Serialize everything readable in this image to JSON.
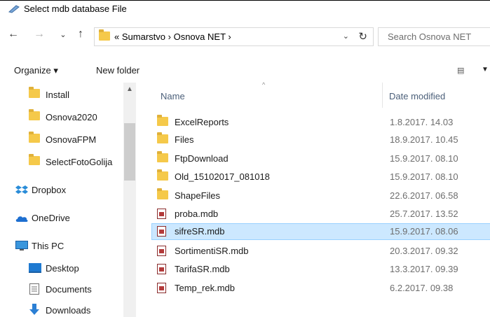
{
  "window": {
    "title": "Select mdb database File"
  },
  "address": {
    "crumb_prefix": "«",
    "crumbs": [
      "Sumarstvo",
      "Osnova NET"
    ],
    "separator": "›"
  },
  "search": {
    "placeholder": "Search Osnova NET"
  },
  "toolbar": {
    "organize": "Organize ▾",
    "new_folder": "New folder"
  },
  "nav": {
    "items": [
      {
        "label": "Install",
        "icon": "folder-icon"
      },
      {
        "label": "Osnova2020",
        "icon": "folder-icon"
      },
      {
        "label": "OsnovaFPM",
        "icon": "folder-icon"
      },
      {
        "label": "SelectFotoGolija",
        "icon": "folder-icon"
      },
      {
        "label": "Dropbox",
        "icon": "dropbox-icon"
      },
      {
        "label": "OneDrive",
        "icon": "onedrive-icon"
      },
      {
        "label": "This PC",
        "icon": "computer-icon"
      },
      {
        "label": "Desktop",
        "icon": "desktop-icon"
      },
      {
        "label": "Documents",
        "icon": "documents-icon"
      },
      {
        "label": "Downloads",
        "icon": "downloads-icon"
      }
    ]
  },
  "columns": {
    "name": "Name",
    "date": "Date modified"
  },
  "files": [
    {
      "name": "ExcelReports",
      "date": "1.8.2017. 14.03",
      "type": "folder"
    },
    {
      "name": "Files",
      "date": "18.9.2017. 10.45",
      "type": "folder"
    },
    {
      "name": "FtpDownload",
      "date": "15.9.2017. 08.10",
      "type": "folder"
    },
    {
      "name": "Old_15102017_081018",
      "date": "15.9.2017. 08.10",
      "type": "folder"
    },
    {
      "name": "ShapeFiles",
      "date": "22.6.2017. 06.58",
      "type": "folder"
    },
    {
      "name": "proba.mdb",
      "date": "25.7.2017. 13.52",
      "type": "mdb"
    },
    {
      "name": "sifreSR.mdb",
      "date": "15.9.2017. 08.06",
      "type": "mdb",
      "selected": true
    },
    {
      "name": "SortimentiSR.mdb",
      "date": "20.3.2017. 09.32",
      "type": "mdb"
    },
    {
      "name": "TarifaSR.mdb",
      "date": "13.3.2017. 09.39",
      "type": "mdb"
    },
    {
      "name": "Temp_rek.mdb",
      "date": "6.2.2017. 09.38",
      "type": "mdb"
    }
  ],
  "colors": {
    "selection_bg": "#cce8ff",
    "selection_border": "#99d1ff",
    "header_text": "#4c607a"
  }
}
